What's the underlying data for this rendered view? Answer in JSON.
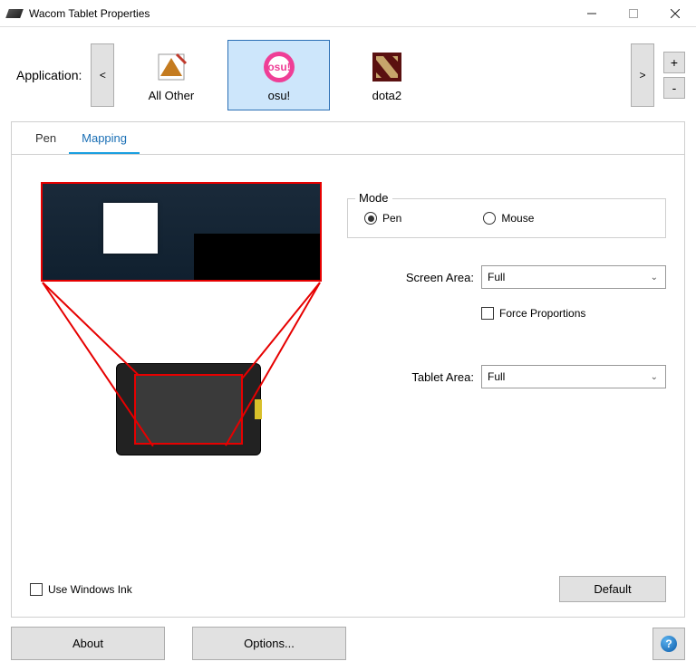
{
  "window": {
    "title": "Wacom Tablet Properties"
  },
  "apps": {
    "label": "Application:",
    "prev": "<",
    "next": ">",
    "add": "+",
    "remove": "-",
    "items": [
      {
        "name": "All Other"
      },
      {
        "name": "osu!"
      },
      {
        "name": "dota2"
      }
    ],
    "selected_index": 1
  },
  "tabs": {
    "pen": "Pen",
    "mapping": "Mapping",
    "active": "mapping"
  },
  "mode": {
    "group_label": "Mode",
    "pen": "Pen",
    "mouse": "Mouse",
    "selected": "pen"
  },
  "screen_area": {
    "label": "Screen Area:",
    "value": "Full"
  },
  "force_proportions": {
    "label": "Force Proportions",
    "checked": false
  },
  "tablet_area": {
    "label": "Tablet Area:",
    "value": "Full"
  },
  "windows_ink": {
    "label": "Use Windows Ink",
    "checked": false
  },
  "buttons": {
    "default": "Default",
    "about": "About",
    "options": "Options..."
  }
}
